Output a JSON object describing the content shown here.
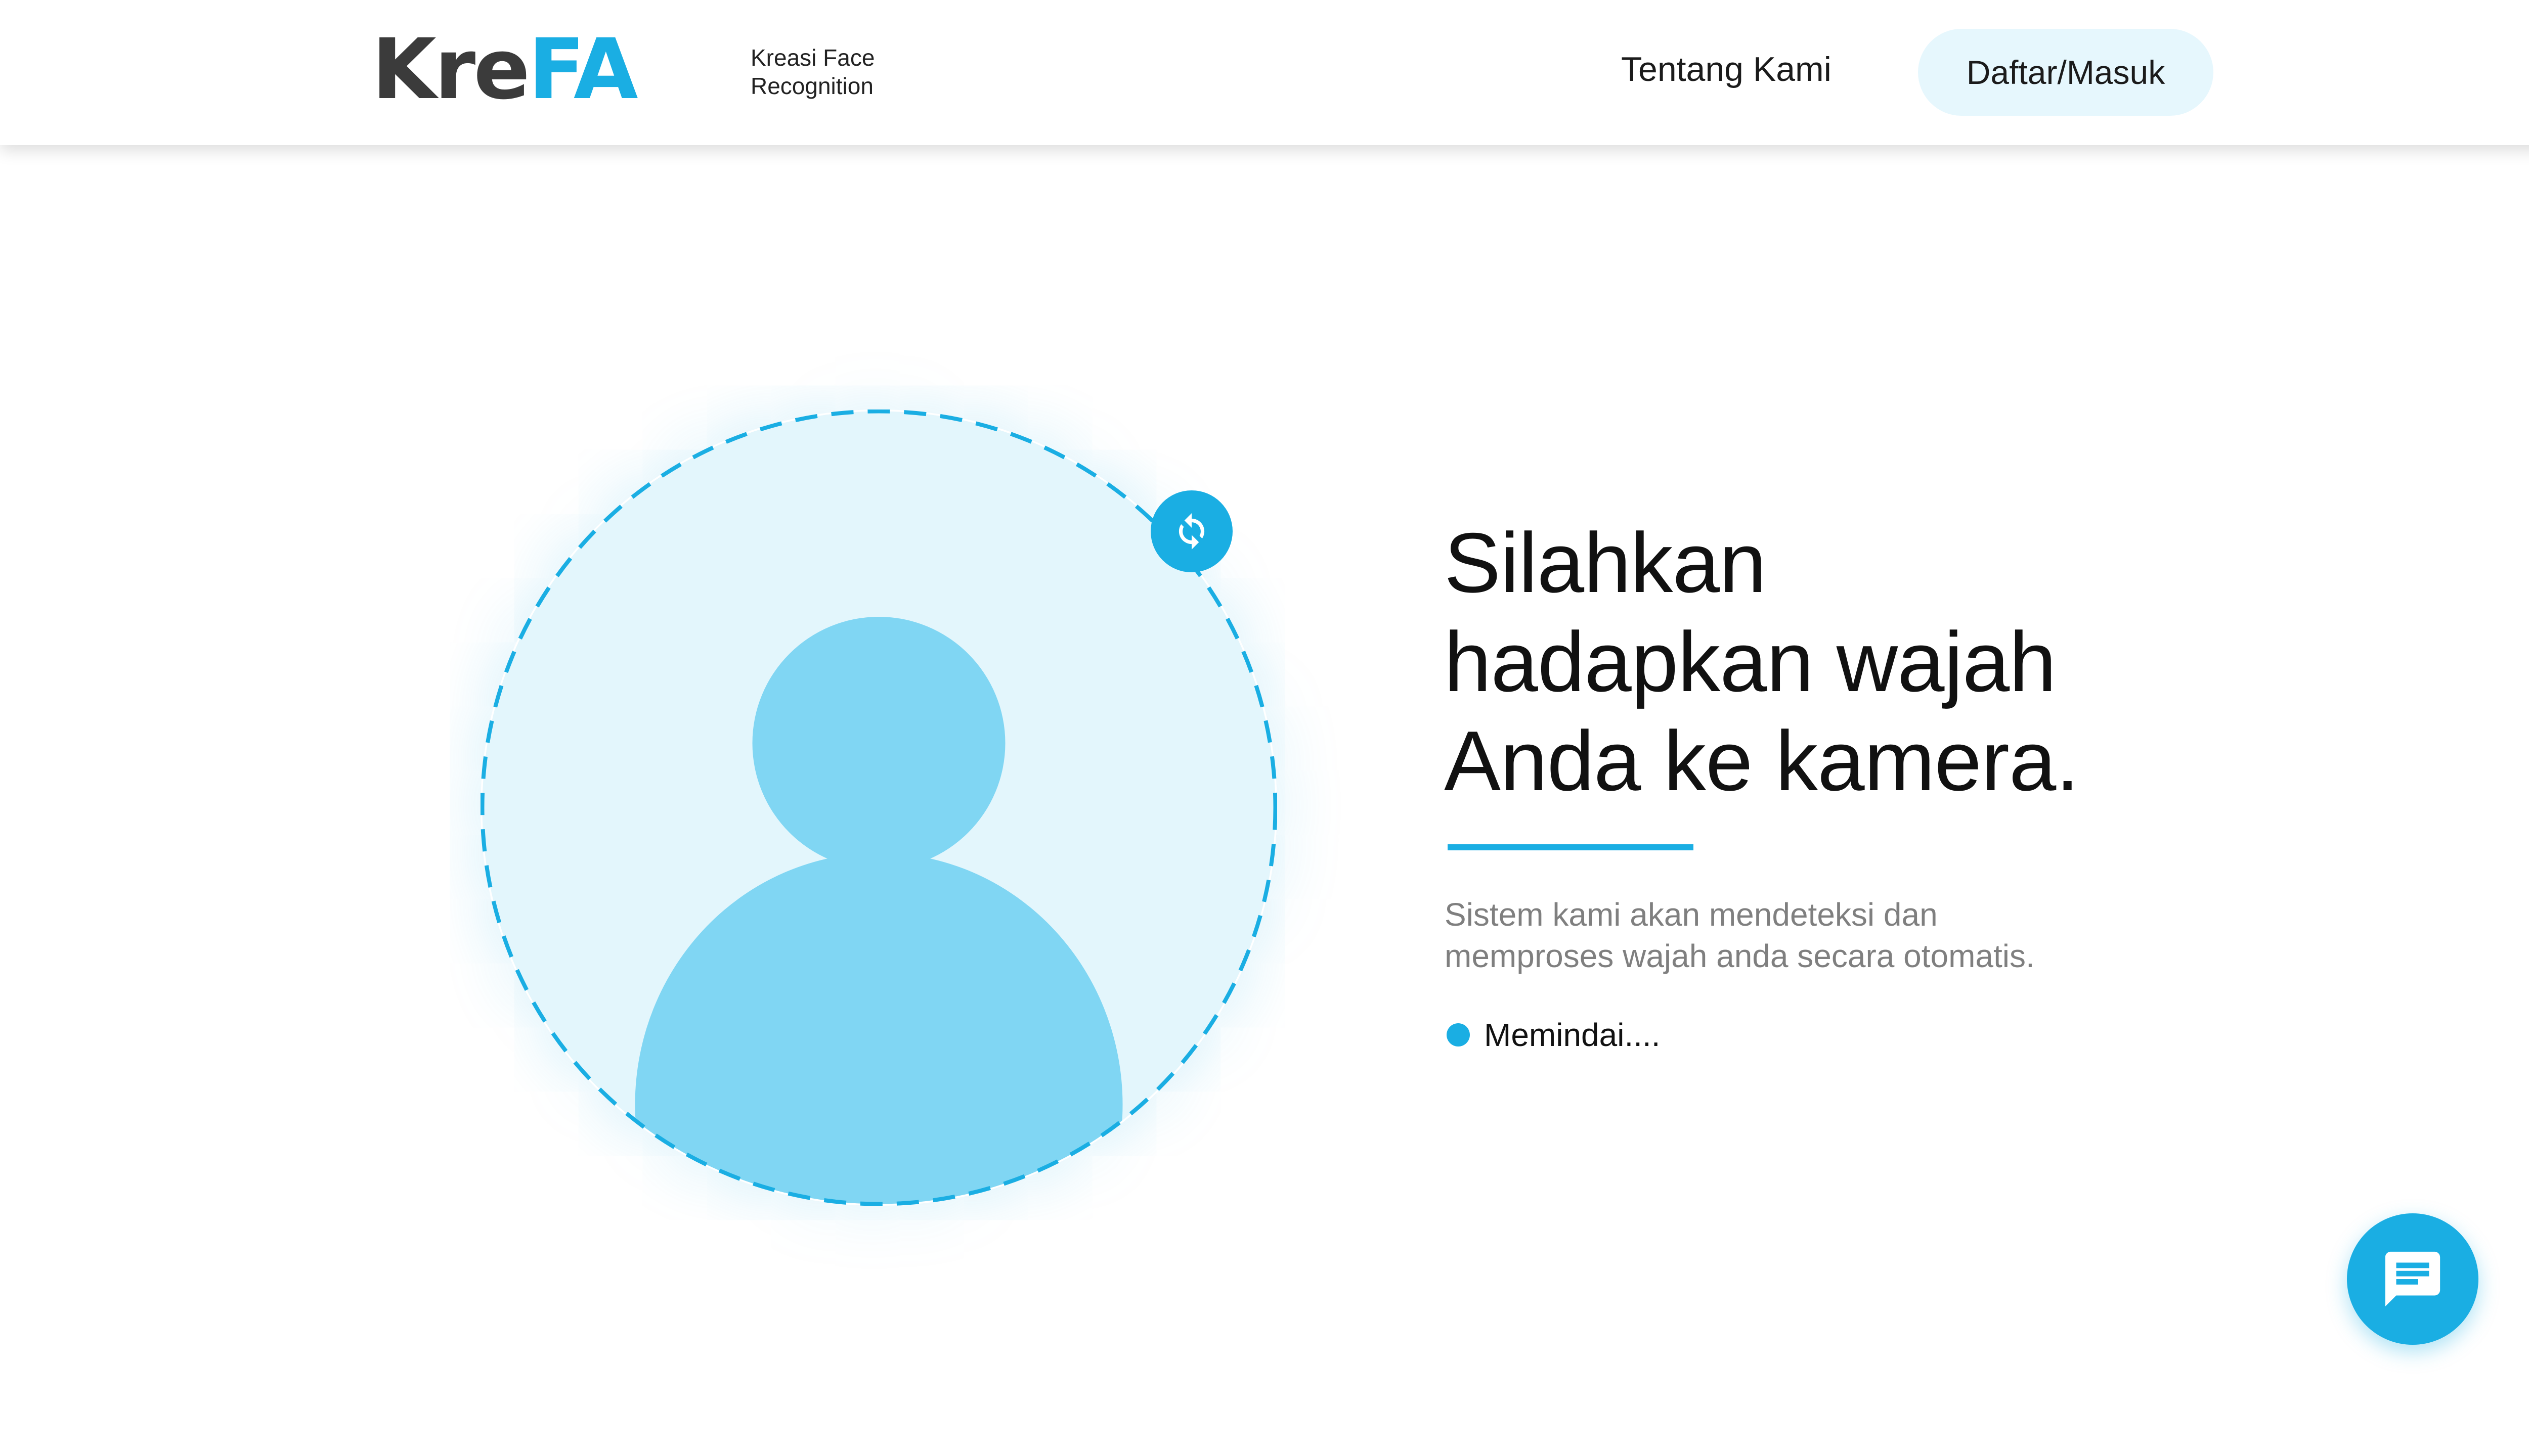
{
  "header": {
    "logo": {
      "part1": "Kre",
      "part2": "FA"
    },
    "tagline": {
      "line1": "Kreasi Face",
      "line2": "Recognition"
    },
    "nav": {
      "about_label": "Tentang Kami",
      "login_label": "Daftar/Masuk"
    }
  },
  "main": {
    "headline": {
      "line1": "Silahkan",
      "line2": "hadapkan wajah",
      "line3": "Anda ke kamera."
    },
    "description": {
      "line1": "Sistem kami akan mendeteksi dan",
      "line2": "memproses wajah anda secara otomatis."
    },
    "status_label": "Memindai...."
  },
  "icons": {
    "refresh": "refresh-icon",
    "avatar": "user-avatar-icon",
    "chat": "chat-icon"
  },
  "colors": {
    "accent": "#1aaee3",
    "circle_fill": "#e3f6fc",
    "avatar_fill": "#80d6f3",
    "logo_dark": "#3b3b3b",
    "button_bg": "#e6f7fd"
  }
}
